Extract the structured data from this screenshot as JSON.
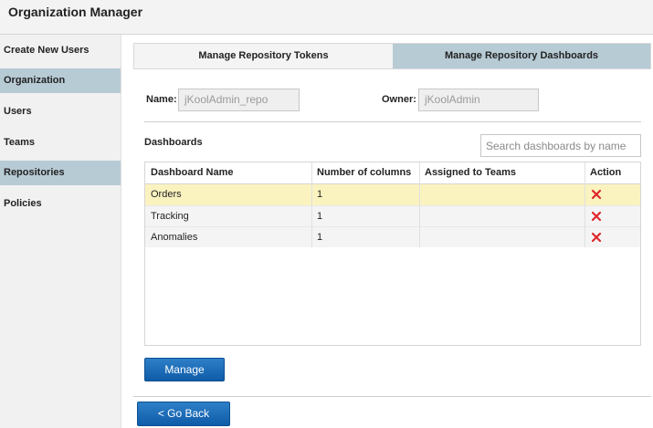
{
  "app": {
    "title": "Organization Manager"
  },
  "sidebar": {
    "items": [
      {
        "label": "Create New Users",
        "active": false
      },
      {
        "label": "Organization",
        "active": true
      },
      {
        "label": "Users",
        "active": false
      },
      {
        "label": "Teams",
        "active": false
      },
      {
        "label": "Repositories",
        "active": true
      },
      {
        "label": "Policies",
        "active": false
      }
    ]
  },
  "tabs": [
    {
      "label": "Manage Repository Tokens",
      "selected": false
    },
    {
      "label": "Manage Repository Dashboards",
      "selected": true
    }
  ],
  "form": {
    "name_label": "Name:",
    "name_value": "jKoolAdmin_repo",
    "owner_label": "Owner:",
    "owner_value": "jKoolAdmin"
  },
  "dashboards": {
    "section_title": "Dashboards",
    "search_placeholder": "Search dashboards by name",
    "columns": [
      "Dashboard Name",
      "Number of columns",
      "Assigned to Teams",
      "Action"
    ],
    "rows": [
      {
        "name": "Orders",
        "columns": "1",
        "teams": ""
      },
      {
        "name": "Tracking",
        "columns": "1",
        "teams": ""
      },
      {
        "name": "Anomalies",
        "columns": "1",
        "teams": ""
      }
    ],
    "delete_icon": "close-x-icon",
    "delete_color": "#e0262b"
  },
  "buttons": {
    "manage_label": "Manage",
    "go_back_label": "< Go Back"
  },
  "colors": {
    "active_tab": "#b7cbd5",
    "selected_row": "#fbf3bf",
    "button": "#1a6bb8"
  }
}
